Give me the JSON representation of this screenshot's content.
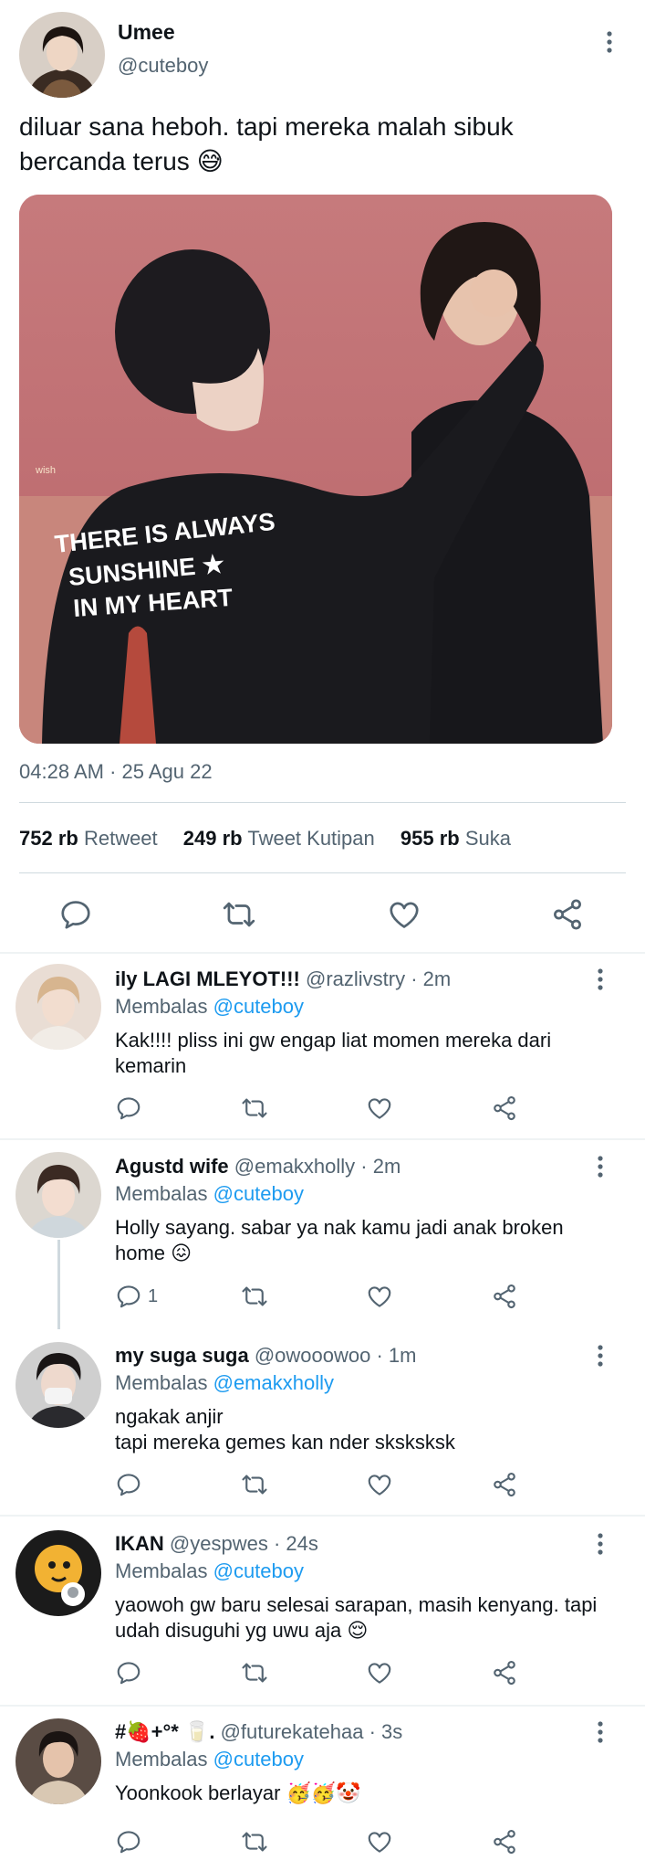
{
  "tweet": {
    "author_name": "Umee",
    "author_handle": "@cuteboy",
    "text": "diluar sana heboh. tapi mereka malah sibuk bercanda terus 😅",
    "photo_text_line1": "THERE IS ALWAYS",
    "photo_text_line2": "SUNSHINE ★",
    "photo_text_line3": "IN MY HEART",
    "photo_watermark": "wish",
    "timestamp": "04:28 AM · 25 Agu 22",
    "stats": {
      "retweets_count": "752 rb",
      "retweets_label": "Retweet",
      "quotes_count": "249 rb",
      "quotes_label": "Tweet Kutipan",
      "likes_count": "955 rb",
      "likes_label": "Suka"
    }
  },
  "replies": [
    {
      "name": "ily LAGI MLEYOT!!!",
      "meta": "@razlivstry · 2m",
      "replying_label": "Membalas",
      "replying_to": "@cuteboy",
      "text": "Kak!!!! pliss ini gw engap liat momen mereka dari kemarin",
      "reply_count": ""
    },
    {
      "name": "Agustd wife",
      "meta": "@emakxholly · 2m",
      "replying_label": "Membalas",
      "replying_to": "@cuteboy",
      "text": "Holly sayang. sabar ya nak kamu jadi anak broken home 😖",
      "reply_count": "1"
    },
    {
      "name": "my suga suga",
      "meta": "@owooowoo · 1m",
      "replying_label": "Membalas",
      "replying_to": "@emakxholly",
      "text_line1": "ngakak anjir",
      "text_line2": "tapi mereka gemes kan nder sksksksk",
      "reply_count": ""
    },
    {
      "name": "IKAN",
      "meta": "@yespwes · 24s",
      "replying_label": "Membalas",
      "replying_to": "@cuteboy",
      "text": "yaowoh gw baru selesai sarapan, masih kenyang. tapi udah disuguhi yg uwu aja 😌",
      "reply_count": ""
    },
    {
      "name": "#🍓+°* 🥛.",
      "meta": "@futurekatehaa · 3s",
      "replying_label": "Membalas",
      "replying_to": "@cuteboy",
      "text": "Yoonkook berlayar 🥳🥳🤡",
      "reply_count": ""
    }
  ],
  "icons": {
    "reply": "reply-icon",
    "retweet": "retweet-icon",
    "like": "heart-icon",
    "share": "share-icon",
    "more": "more-vertical-icon"
  },
  "colors": {
    "text": "#0f1419",
    "secondary": "#536471",
    "accent": "#1d9bf0",
    "divider": "#cfd9de"
  }
}
